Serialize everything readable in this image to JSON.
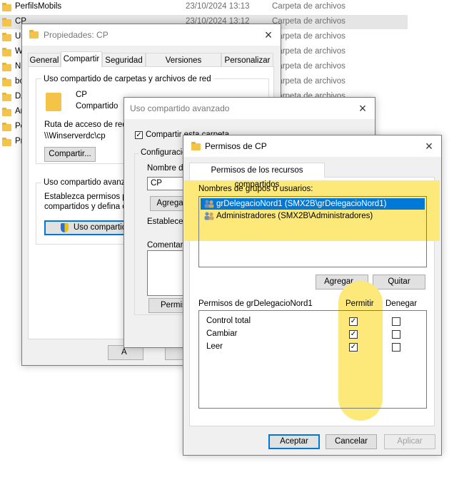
{
  "explorer": {
    "rows": [
      {
        "name": "PerfilsMobils",
        "date": "23/10/2024 13:13",
        "type": "Carpeta de archivos"
      },
      {
        "name": "CP",
        "date": "23/10/2024 13:12",
        "type": "Carpeta de archivos"
      },
      {
        "name": "Us",
        "date": "",
        "type": "Carpeta de archivos"
      },
      {
        "name": "W",
        "date": "",
        "type": "Carpeta de archivos"
      },
      {
        "name": "N",
        "date": "",
        "type": "Carpeta de archivos"
      },
      {
        "name": "bo",
        "date": "",
        "type": "Carpeta de archivos"
      },
      {
        "name": "DA",
        "date": "",
        "type": "Carpeta de archivos"
      },
      {
        "name": "An",
        "date": "",
        "type": "Carpeta de archivos"
      },
      {
        "name": "Pe",
        "date": "",
        "type": "Carpeta de archivos"
      },
      {
        "name": "Pr",
        "date": "",
        "type": "Carpeta de archivos"
      }
    ]
  },
  "props": {
    "title": "Propiedades: CP",
    "tabs": [
      "General",
      "Compartir",
      "Seguridad",
      "Versiones anteriores",
      "Personalizar"
    ],
    "group1_label": "Uso compartido de carpetas y archivos de red",
    "share_name": "CP",
    "share_state": "Compartido",
    "path_label": "Ruta de acceso de red:",
    "path_value": "\\\\Winserverdc\\cp",
    "share_button": "Compartir...",
    "group2_label": "Uso compartido avanzado",
    "group2_text1": "Establezca permisos per",
    "group2_text2": "compartidos y defina otr",
    "advanced_button": "Uso compartido",
    "ok_partial": "A"
  },
  "advanced": {
    "title": "Uso compartido avanzado",
    "share_checkbox": "Compartir esta carpeta",
    "config_label": "Configuración",
    "name_label": "Nombre de",
    "name_value": "CP",
    "add_button": "Agregar",
    "limit_label": "Establecer",
    "comment_label": "Comentari",
    "perm_button": "Permis"
  },
  "perm": {
    "title": "Permisos de CP",
    "tab": "Permisos de los recursos compartidos",
    "groups_label": "Nombres de grupos o usuarios:",
    "users": [
      {
        "label": "grDelegacioNord1 (SMX2B\\grDelegacioNord1)",
        "selected": true
      },
      {
        "label": "Administradores (SMX2B\\Administradores)",
        "selected": false
      }
    ],
    "add_button": "Agregar...",
    "remove_button": "Quitar",
    "perm_for": "Permisos de grDelegacioNord1",
    "allow_header": "Permitir",
    "deny_header": "Denegar",
    "rows": [
      {
        "label": "Control total",
        "allow": true,
        "deny": false
      },
      {
        "label": "Cambiar",
        "allow": true,
        "deny": false
      },
      {
        "label": "Leer",
        "allow": true,
        "deny": false
      }
    ],
    "ok": "Aceptar",
    "cancel": "Cancelar",
    "apply": "Aplicar"
  },
  "colors": {
    "highlight_yellow": "#fde97a",
    "selection_blue": "#0078d7"
  }
}
